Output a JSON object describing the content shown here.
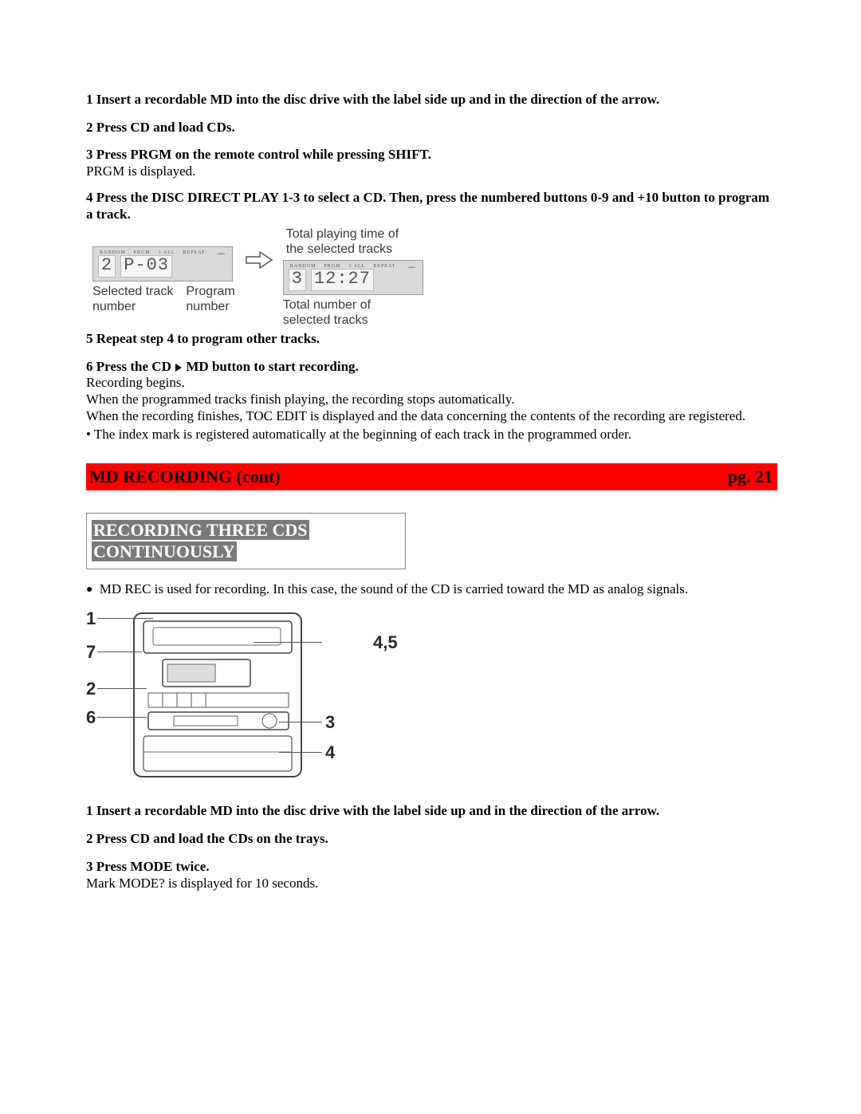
{
  "steps_top": {
    "s1": "1 Insert a recordable MD into the disc drive with the label side up and in the direction of the arrow.",
    "s2": "2 Press CD and load CDs.",
    "s3_bold": "3 Press PRGM on the remote control while pressing SHIFT.",
    "s3_note": "PRGM is displayed.",
    "s4": "4 Press the DISC DIRECT PLAY 1-3 to select a CD. Then, press the numbered buttons 0-9 and +10 button to program a track.",
    "s5": "5 Repeat step 4 to program other tracks.",
    "s6_pre": "6 Press the CD",
    "s6_post": "MD button to start recording.",
    "s6_note1": "Recording begins.",
    "s6_note2": "When the programmed tracks finish playing, the recording stops automatically.",
    "s6_note3": "When the recording finishes, TOC EDIT is displayed and the data concerning the contents of the recording are registered.",
    "s6_bullet": "• The index mark is registered automatically at the beginning of each track in the programmed order."
  },
  "display_fig": {
    "right_top_caption": "Total playing time of\nthe selected tracks",
    "panel1_seg1": "2",
    "panel1_seg2": "P-03",
    "panel2_seg1": "3",
    "panel2_seg2": "12:27",
    "left_label1": "Selected track\nnumber",
    "left_label2": "Program\nnumber",
    "right_label": "Total number of\nselected tracks",
    "indicator_labels": [
      "RANDOM",
      "PRGM",
      "1 ALL",
      "REPEAT"
    ]
  },
  "section_bar": {
    "title": "MD RECORDING (cont)",
    "page": "pg. 21"
  },
  "sub_heading": {
    "line1": "RECORDING THREE CDS",
    "line2": "CONTINUOUSLY"
  },
  "intro_bullet": " MD REC is used for recording.  In this case, the sound of the CD is carried toward the MD as analog signals.",
  "unit_callouts": {
    "c1": "1",
    "c7": "7",
    "c2": "2",
    "c6": "6",
    "c45": "4,5",
    "c3": "3",
    "c4": "4"
  },
  "steps_bottom": {
    "b1": "1 Insert a recordable MD into the disc drive with the label side up and in the direction of the arrow.",
    "b2": "2 Press CD and load the CDs on the trays.",
    "b3_bold": "3 Press MODE twice.",
    "b3_note": "Mark MODE? is displayed for 10 seconds."
  }
}
